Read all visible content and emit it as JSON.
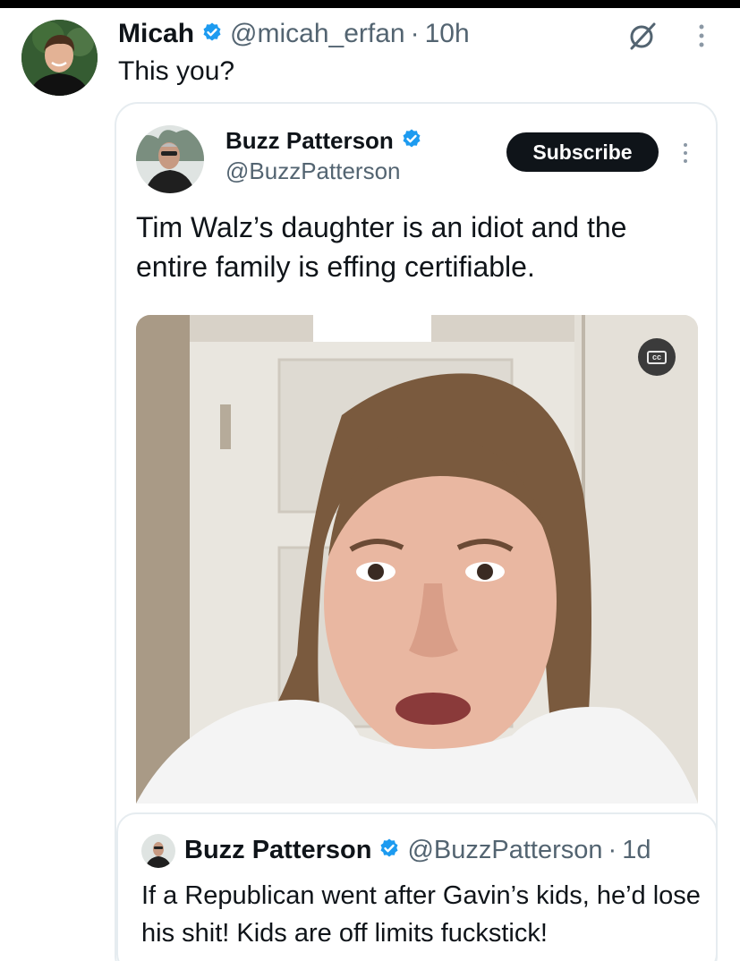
{
  "outer_tweet": {
    "name": "Micah",
    "handle": "@micah_erfan",
    "separator": "·",
    "time": "10h",
    "text": "This you?",
    "icons": {
      "grok": "grok-icon",
      "more": "more-options-icon",
      "verified": "verified-badge-icon"
    }
  },
  "quoted_tweet": {
    "name": "Buzz Patterson",
    "handle": "@BuzzPatterson",
    "subscribe_label": "Subscribe",
    "text": "Tim Walz’s daughter is an idiot and the entire family is effing certifiable.",
    "video": {
      "cc_label": "cc"
    }
  },
  "nested_quote": {
    "name": "Buzz Patterson",
    "handle": "@BuzzPatterson",
    "separator": "·",
    "time": "1d",
    "text": "If a Republican went after Gavin’s kids, he’d lose his shit! Kids are off limits fuckstick!"
  },
  "colors": {
    "verified_blue": "#1d9bf0",
    "secondary_text": "#536471",
    "primary_text": "#0f1419",
    "subscribe_bg": "#0f1419"
  }
}
